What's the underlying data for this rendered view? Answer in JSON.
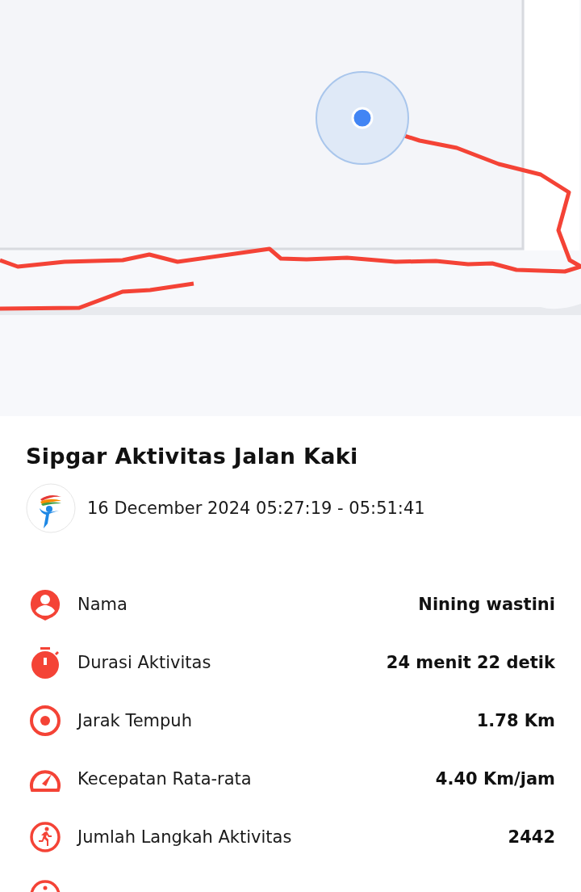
{
  "activity": {
    "title": "Sipgar Aktivitas Jalan Kaki",
    "datetime": "16 December 2024 05:27:19 - 05:51:41"
  },
  "stats": [
    {
      "kind": "person",
      "label": "Nama",
      "value": "Nining wastini"
    },
    {
      "kind": "timer",
      "label": "Durasi Aktivitas",
      "value": "24 menit 22 detik"
    },
    {
      "kind": "target",
      "label": "Jarak Tempuh",
      "value": "1.78 Km"
    },
    {
      "kind": "speed",
      "label": "Kecepatan Rata-rata",
      "value": "4.40 Km/jam"
    },
    {
      "kind": "steps",
      "label": "Jumlah Langkah Aktivitas",
      "value": "2442"
    },
    {
      "kind": "info"
    }
  ]
}
